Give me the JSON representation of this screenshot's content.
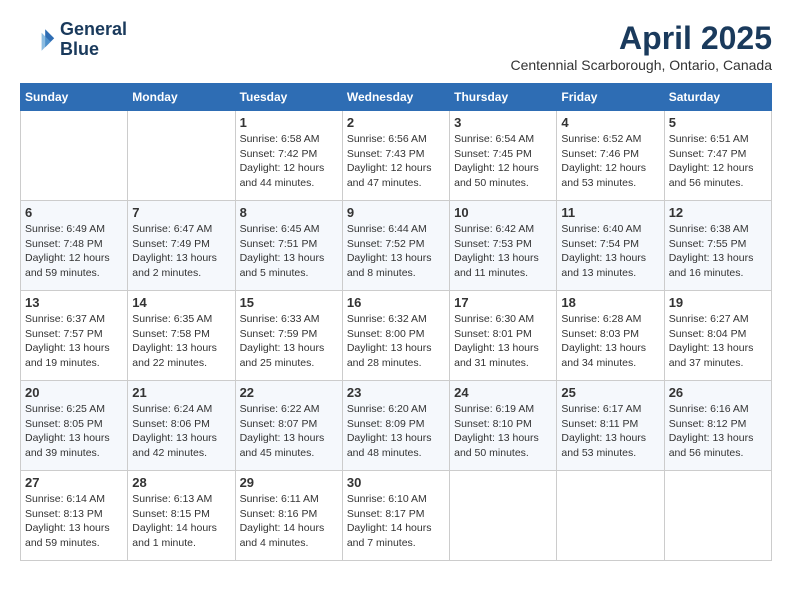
{
  "header": {
    "logo_line1": "General",
    "logo_line2": "Blue",
    "month_year": "April 2025",
    "location": "Centennial Scarborough, Ontario, Canada"
  },
  "days_of_week": [
    "Sunday",
    "Monday",
    "Tuesday",
    "Wednesday",
    "Thursday",
    "Friday",
    "Saturday"
  ],
  "weeks": [
    [
      {
        "day": "",
        "sunrise": "",
        "sunset": "",
        "daylight": ""
      },
      {
        "day": "",
        "sunrise": "",
        "sunset": "",
        "daylight": ""
      },
      {
        "day": "1",
        "sunrise": "Sunrise: 6:58 AM",
        "sunset": "Sunset: 7:42 PM",
        "daylight": "Daylight: 12 hours and 44 minutes."
      },
      {
        "day": "2",
        "sunrise": "Sunrise: 6:56 AM",
        "sunset": "Sunset: 7:43 PM",
        "daylight": "Daylight: 12 hours and 47 minutes."
      },
      {
        "day": "3",
        "sunrise": "Sunrise: 6:54 AM",
        "sunset": "Sunset: 7:45 PM",
        "daylight": "Daylight: 12 hours and 50 minutes."
      },
      {
        "day": "4",
        "sunrise": "Sunrise: 6:52 AM",
        "sunset": "Sunset: 7:46 PM",
        "daylight": "Daylight: 12 hours and 53 minutes."
      },
      {
        "day": "5",
        "sunrise": "Sunrise: 6:51 AM",
        "sunset": "Sunset: 7:47 PM",
        "daylight": "Daylight: 12 hours and 56 minutes."
      }
    ],
    [
      {
        "day": "6",
        "sunrise": "Sunrise: 6:49 AM",
        "sunset": "Sunset: 7:48 PM",
        "daylight": "Daylight: 12 hours and 59 minutes."
      },
      {
        "day": "7",
        "sunrise": "Sunrise: 6:47 AM",
        "sunset": "Sunset: 7:49 PM",
        "daylight": "Daylight: 13 hours and 2 minutes."
      },
      {
        "day": "8",
        "sunrise": "Sunrise: 6:45 AM",
        "sunset": "Sunset: 7:51 PM",
        "daylight": "Daylight: 13 hours and 5 minutes."
      },
      {
        "day": "9",
        "sunrise": "Sunrise: 6:44 AM",
        "sunset": "Sunset: 7:52 PM",
        "daylight": "Daylight: 13 hours and 8 minutes."
      },
      {
        "day": "10",
        "sunrise": "Sunrise: 6:42 AM",
        "sunset": "Sunset: 7:53 PM",
        "daylight": "Daylight: 13 hours and 11 minutes."
      },
      {
        "day": "11",
        "sunrise": "Sunrise: 6:40 AM",
        "sunset": "Sunset: 7:54 PM",
        "daylight": "Daylight: 13 hours and 13 minutes."
      },
      {
        "day": "12",
        "sunrise": "Sunrise: 6:38 AM",
        "sunset": "Sunset: 7:55 PM",
        "daylight": "Daylight: 13 hours and 16 minutes."
      }
    ],
    [
      {
        "day": "13",
        "sunrise": "Sunrise: 6:37 AM",
        "sunset": "Sunset: 7:57 PM",
        "daylight": "Daylight: 13 hours and 19 minutes."
      },
      {
        "day": "14",
        "sunrise": "Sunrise: 6:35 AM",
        "sunset": "Sunset: 7:58 PM",
        "daylight": "Daylight: 13 hours and 22 minutes."
      },
      {
        "day": "15",
        "sunrise": "Sunrise: 6:33 AM",
        "sunset": "Sunset: 7:59 PM",
        "daylight": "Daylight: 13 hours and 25 minutes."
      },
      {
        "day": "16",
        "sunrise": "Sunrise: 6:32 AM",
        "sunset": "Sunset: 8:00 PM",
        "daylight": "Daylight: 13 hours and 28 minutes."
      },
      {
        "day": "17",
        "sunrise": "Sunrise: 6:30 AM",
        "sunset": "Sunset: 8:01 PM",
        "daylight": "Daylight: 13 hours and 31 minutes."
      },
      {
        "day": "18",
        "sunrise": "Sunrise: 6:28 AM",
        "sunset": "Sunset: 8:03 PM",
        "daylight": "Daylight: 13 hours and 34 minutes."
      },
      {
        "day": "19",
        "sunrise": "Sunrise: 6:27 AM",
        "sunset": "Sunset: 8:04 PM",
        "daylight": "Daylight: 13 hours and 37 minutes."
      }
    ],
    [
      {
        "day": "20",
        "sunrise": "Sunrise: 6:25 AM",
        "sunset": "Sunset: 8:05 PM",
        "daylight": "Daylight: 13 hours and 39 minutes."
      },
      {
        "day": "21",
        "sunrise": "Sunrise: 6:24 AM",
        "sunset": "Sunset: 8:06 PM",
        "daylight": "Daylight: 13 hours and 42 minutes."
      },
      {
        "day": "22",
        "sunrise": "Sunrise: 6:22 AM",
        "sunset": "Sunset: 8:07 PM",
        "daylight": "Daylight: 13 hours and 45 minutes."
      },
      {
        "day": "23",
        "sunrise": "Sunrise: 6:20 AM",
        "sunset": "Sunset: 8:09 PM",
        "daylight": "Daylight: 13 hours and 48 minutes."
      },
      {
        "day": "24",
        "sunrise": "Sunrise: 6:19 AM",
        "sunset": "Sunset: 8:10 PM",
        "daylight": "Daylight: 13 hours and 50 minutes."
      },
      {
        "day": "25",
        "sunrise": "Sunrise: 6:17 AM",
        "sunset": "Sunset: 8:11 PM",
        "daylight": "Daylight: 13 hours and 53 minutes."
      },
      {
        "day": "26",
        "sunrise": "Sunrise: 6:16 AM",
        "sunset": "Sunset: 8:12 PM",
        "daylight": "Daylight: 13 hours and 56 minutes."
      }
    ],
    [
      {
        "day": "27",
        "sunrise": "Sunrise: 6:14 AM",
        "sunset": "Sunset: 8:13 PM",
        "daylight": "Daylight: 13 hours and 59 minutes."
      },
      {
        "day": "28",
        "sunrise": "Sunrise: 6:13 AM",
        "sunset": "Sunset: 8:15 PM",
        "daylight": "Daylight: 14 hours and 1 minute."
      },
      {
        "day": "29",
        "sunrise": "Sunrise: 6:11 AM",
        "sunset": "Sunset: 8:16 PM",
        "daylight": "Daylight: 14 hours and 4 minutes."
      },
      {
        "day": "30",
        "sunrise": "Sunrise: 6:10 AM",
        "sunset": "Sunset: 8:17 PM",
        "daylight": "Daylight: 14 hours and 7 minutes."
      },
      {
        "day": "",
        "sunrise": "",
        "sunset": "",
        "daylight": ""
      },
      {
        "day": "",
        "sunrise": "",
        "sunset": "",
        "daylight": ""
      },
      {
        "day": "",
        "sunrise": "",
        "sunset": "",
        "daylight": ""
      }
    ]
  ]
}
